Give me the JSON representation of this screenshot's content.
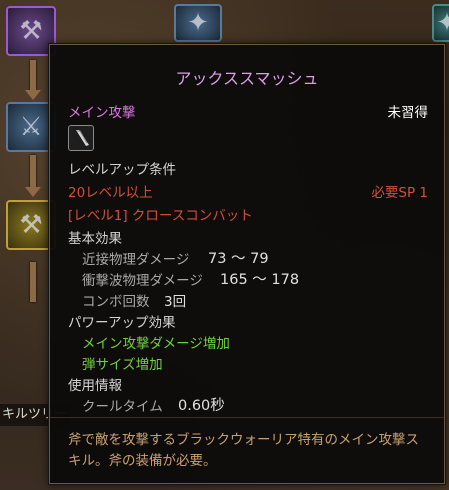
{
  "skill_tree": {
    "label": "キルツリー",
    "nodes": [
      {
        "icon": "axe-icon",
        "color": "purple"
      },
      {
        "icon": "blue-skill-icon",
        "color": "blue"
      },
      {
        "icon": "gold-axe-icon",
        "color": "gold"
      },
      {
        "icon": "blue-crest-icon",
        "color": "blue"
      },
      {
        "icon": "teal-skill-icon",
        "color": "teal"
      }
    ]
  },
  "tooltip": {
    "title": "アックススマッシュ",
    "skill_type": "メイン攻撃",
    "status": "未習得",
    "weapon_icon": "axe-weapon-icon",
    "requirements_heading": "レベルアップ条件",
    "level_req": "20レベル以上",
    "sp_req": "必要SP 1",
    "prereq": "[レベル1] クロースコンバット",
    "basic_effects_heading": "基本効果",
    "effects": [
      {
        "label": "近接物理ダメージ",
        "value": "73 ～ 79"
      },
      {
        "label": "衝撃波物理ダメージ",
        "value": "165 ～ 178"
      },
      {
        "label": "コンボ回数",
        "value": "3回"
      }
    ],
    "powerup_heading": "パワーアップ効果",
    "powerups": [
      "メイン攻撃ダメージ増加",
      "弾サイズ増加"
    ],
    "usage_heading": "使用情報",
    "cooldown_label": "クールタイム",
    "cooldown_value": "0.60秒",
    "description": "斧で敵を攻撃するブラックウォーリア特有のメイン攻撃スキル。斧の装備が必要。"
  }
}
